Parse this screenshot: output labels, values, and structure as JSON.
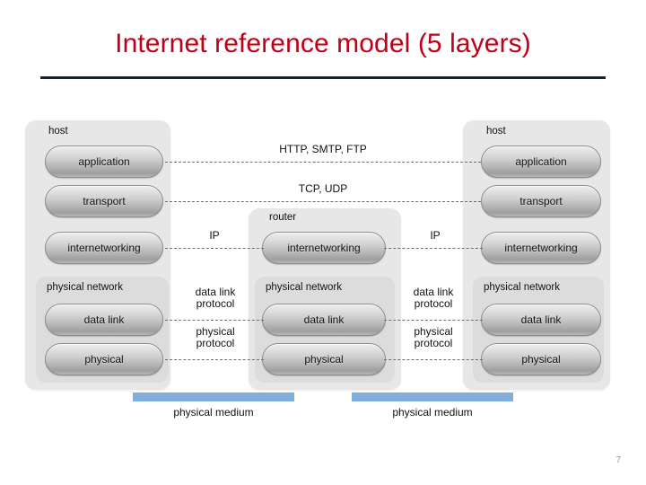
{
  "slide": {
    "title": "Internet reference model (5 layers)",
    "page_number": "7",
    "title_color": "#c00018",
    "rule_color": "#0d2240"
  },
  "diagram": {
    "columns": {
      "left_host": {
        "label": "host",
        "layers": [
          {
            "label": "application"
          },
          {
            "label": "transport"
          },
          {
            "label": "internetworking"
          }
        ],
        "subgroup": {
          "label": "physical network",
          "layers": [
            {
              "label": "data link"
            },
            {
              "label": "physical"
            }
          ]
        }
      },
      "router": {
        "label": "router",
        "layers": [
          {
            "label": "internetworking"
          }
        ],
        "subgroup": {
          "label": "physical network",
          "layers": [
            {
              "label": "data link"
            },
            {
              "label": "physical"
            }
          ]
        }
      },
      "right_host": {
        "label": "host",
        "layers": [
          {
            "label": "application"
          },
          {
            "label": "transport"
          },
          {
            "label": "internetworking"
          }
        ],
        "subgroup": {
          "label": "physical network",
          "layers": [
            {
              "label": "data link"
            },
            {
              "label": "physical"
            }
          ]
        }
      }
    },
    "protocols": {
      "application": "HTTP, SMTP, FTP",
      "transport": "TCP, UDP",
      "internetworking_left": "IP",
      "internetworking_right": "IP",
      "datalink_left_line1": "data link",
      "datalink_left_line2": "protocol",
      "physical_left_line1": "physical",
      "physical_left_line2": "protocol",
      "datalink_right_line1": "data link",
      "datalink_right_line2": "protocol",
      "physical_right_line1": "physical",
      "physical_right_line2": "protocol"
    },
    "media": {
      "left_label": "physical medium",
      "right_label": "physical medium",
      "bar_color": "#82aedb"
    }
  }
}
